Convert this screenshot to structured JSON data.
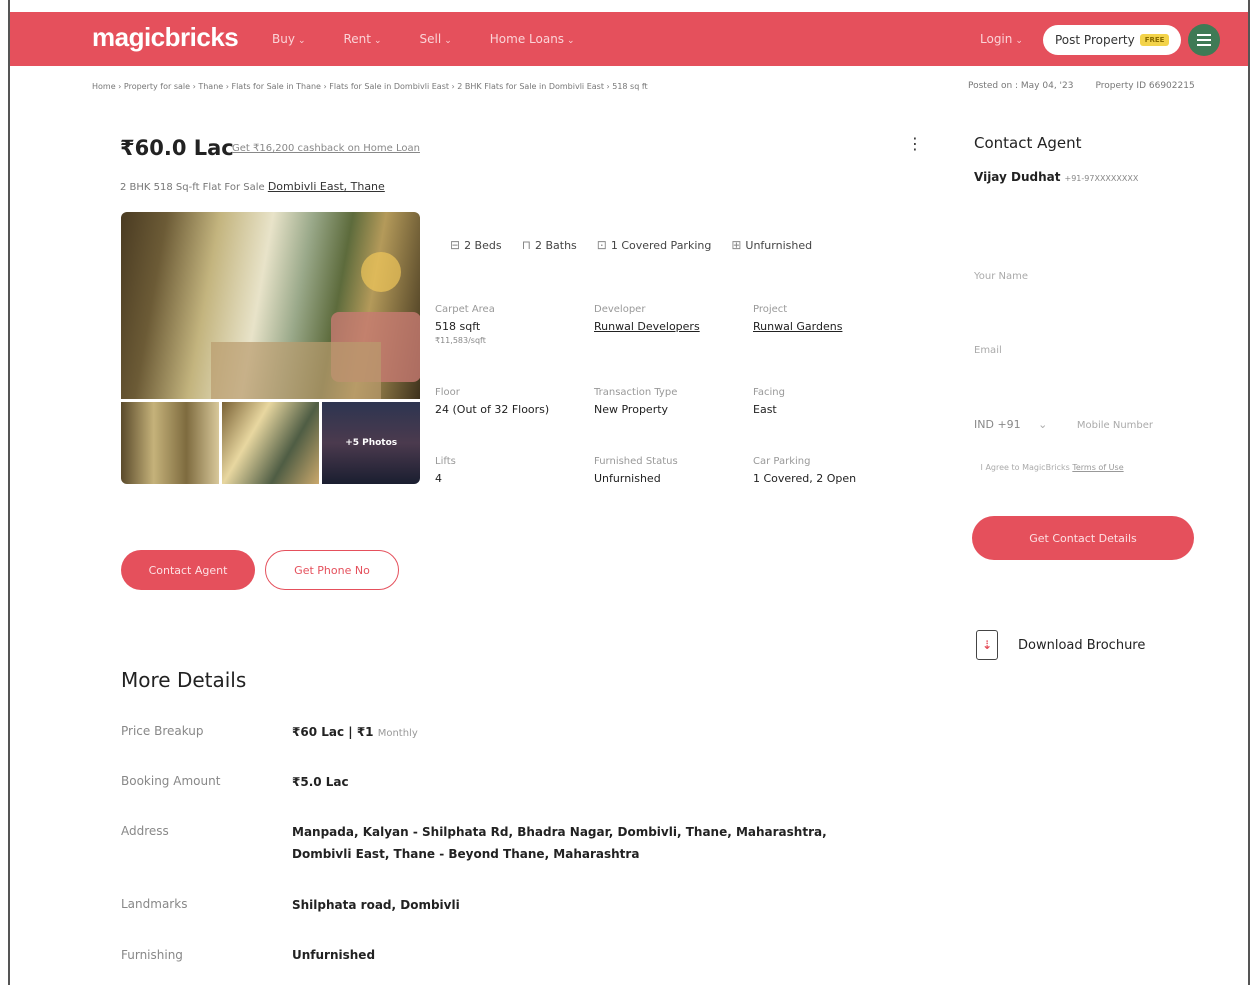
{
  "header": {
    "logo": "magicbricks",
    "nav": [
      {
        "label": "Buy"
      },
      {
        "label": "Rent"
      },
      {
        "label": "Sell"
      },
      {
        "label": "Home Loans"
      }
    ],
    "login": "Login",
    "post_property": "Post Property",
    "free_badge": "FREE"
  },
  "breadcrumb": "Home › Property for sale › Thane › Flats for Sale in Thane › Flats for Sale in Dombivli East › 2 BHK Flats for Sale in Dombivli East › 518 sq ft",
  "posted": {
    "posted_on": "Posted on : May 04, '23",
    "property_id": "Property ID 66902215"
  },
  "listing": {
    "price": "₹60.0 Lac",
    "cashback": "Get ₹16,200 cashback on Home Loan",
    "subtitle_prefix": "2 BHK 518 Sq-ft Flat For Sale",
    "location": "Dombivli East, Thane",
    "more_photos": "+5 Photos"
  },
  "amenities": [
    {
      "icon": "bed-icon",
      "label": "2 Beds"
    },
    {
      "icon": "bath-icon",
      "label": "2 Baths"
    },
    {
      "icon": "parking-icon",
      "label": "1 Covered Parking"
    },
    {
      "icon": "furniture-icon",
      "label": "Unfurnished"
    }
  ],
  "specs": {
    "carpet_area_label": "Carpet Area",
    "carpet_area": "518 sqft",
    "carpet_rate": "₹11,583/sqft",
    "developer_label": "Developer",
    "developer": "Runwal Developers",
    "project_label": "Project",
    "project": "Runwal Gardens",
    "floor_label": "Floor",
    "floor": "24 (Out of 32 Floors)",
    "transaction_label": "Transaction Type",
    "transaction": "New Property",
    "facing_label": "Facing",
    "facing": "East",
    "lifts_label": "Lifts",
    "lifts": "4",
    "furnished_label": "Furnished Status",
    "furnished": "Unfurnished",
    "car_parking_label": "Car Parking",
    "car_parking": "1 Covered, 2 Open"
  },
  "actions": {
    "contact_agent": "Contact Agent",
    "get_phone": "Get Phone No"
  },
  "more_details": {
    "title": "More Details",
    "price_breakup_label": "Price Breakup",
    "price_breakup": "₹60 Lac | ₹1",
    "price_breakup_suffix": "Monthly",
    "booking_label": "Booking Amount",
    "booking": "₹5.0 Lac",
    "address_label": "Address",
    "address_line1": "Manpada, Kalyan - Shilphata Rd, Bhadra Nagar, Dombivli, Thane, Maharashtra,",
    "address_line2": "Dombivli East, Thane - Beyond Thane, Maharashtra",
    "landmarks_label": "Landmarks",
    "landmarks": "Shilphata road, Dombivli",
    "furnishing_label": "Furnishing",
    "furnishing": "Unfurnished"
  },
  "contact_panel": {
    "title": "Contact Agent",
    "agent_name": "Vijay Dudhat",
    "agent_phone": "+91-97XXXXXXXX",
    "name_placeholder": "Your Name",
    "email_placeholder": "Email",
    "country_code": "IND +91",
    "mobile_placeholder": "Mobile Number",
    "terms_prefix": "I Agree to MagicBricks",
    "terms_link": "Terms of Use",
    "get_contact": "Get Contact Details",
    "download_brochure": "Download Brochure"
  }
}
